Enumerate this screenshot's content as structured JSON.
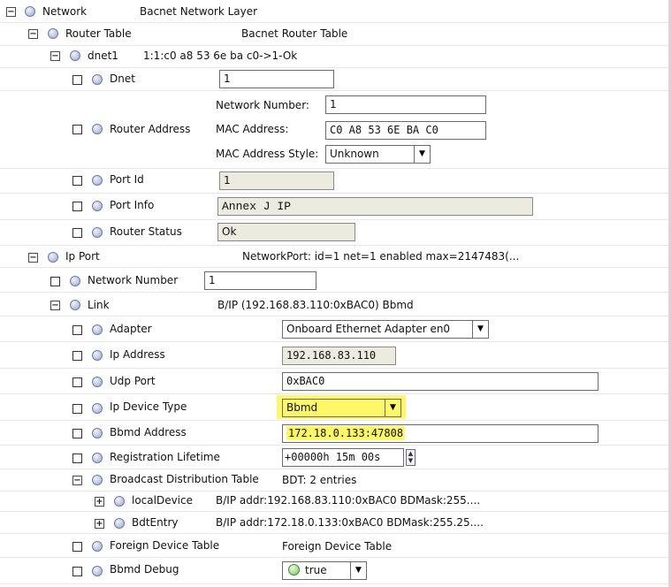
{
  "tree": {
    "network": {
      "label": "Network",
      "value": "Bacnet Network Layer"
    },
    "router_table": {
      "label": "Router Table",
      "value": "Bacnet Router Table"
    },
    "dnet1": {
      "label": "dnet1",
      "value": "1:1:c0 a8 53 6e ba c0->1-Ok"
    },
    "dnet": {
      "label": "Dnet",
      "value": "1"
    },
    "router_address": {
      "label": "Router Address",
      "network_number_label": "Network Number:",
      "network_number_value": "1",
      "mac_label": "MAC Address:",
      "mac_value": "C0 A8 53 6E BA C0",
      "mac_style_label": "MAC Address Style:",
      "mac_style_value": "Unknown"
    },
    "port_id": {
      "label": "Port Id",
      "value": "1"
    },
    "port_info": {
      "label": "Port Info",
      "value": "Annex J IP"
    },
    "router_status": {
      "label": "Router Status",
      "value": "Ok"
    },
    "ip_port": {
      "label": "Ip Port",
      "value": "NetworkPort: id=1 net=1 enabled max=2147483(..."
    },
    "network_number": {
      "label": "Network Number",
      "value": "1"
    },
    "link": {
      "label": "Link",
      "value": "B/IP (192.168.83.110:0xBAC0) Bbmd"
    },
    "adapter": {
      "label": "Adapter",
      "value": "Onboard Ethernet Adapter en0"
    },
    "ip_address": {
      "label": "Ip Address",
      "value": "192.168.83.110"
    },
    "udp_port": {
      "label": "Udp Port",
      "value": "0xBAC0"
    },
    "ip_device_type": {
      "label": "Ip Device Type",
      "value": "Bbmd"
    },
    "bbmd_address": {
      "label": "Bbmd Address",
      "value": "172.18.0.133:47808"
    },
    "registration_lifetime": {
      "label": "Registration Lifetime",
      "value": "+00000h 15m 00s"
    },
    "bdt": {
      "label": "Broadcast Distribution Table",
      "value": "BDT: 2 entries"
    },
    "local_device": {
      "label": "localDevice",
      "value": "B/IP addr:192.168.83.110:0xBAC0  BDMask:255...."
    },
    "bdt_entry": {
      "label": "BdtEntry",
      "value": "B/IP addr:172.18.0.133:0xBAC0  BDMask:255.25...."
    },
    "foreign_device_table": {
      "label": "Foreign Device Table",
      "value": "Foreign Device Table"
    },
    "bbmd_debug": {
      "label": "Bbmd Debug",
      "value": "true"
    }
  },
  "icons": {
    "expand": "plus-box-icon",
    "collapse": "minus-box-icon",
    "check": "checkbox-icon",
    "node": "slot-bullet-icon",
    "dropdown": "chevron-down-icon"
  },
  "colors": {
    "highlight": "#fff76a",
    "readonly_bg": "#ecebdf",
    "node_bullet": "#b6bde0"
  }
}
